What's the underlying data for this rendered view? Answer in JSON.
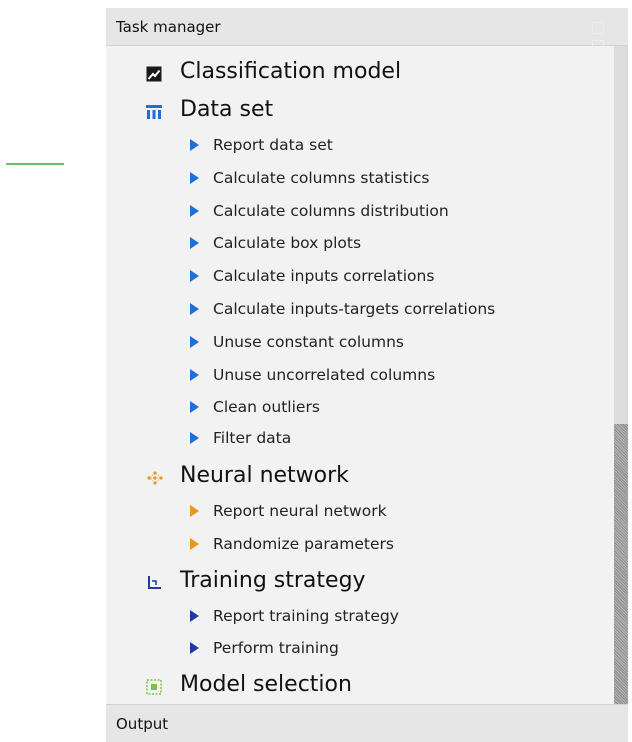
{
  "panel": {
    "title": "Task manager"
  },
  "tree": {
    "categories": [
      {
        "label": "Classification model",
        "icon": "chart-square-icon"
      },
      {
        "label": "Data set",
        "icon": "table-icon",
        "tasks": [
          "Report data set",
          "Calculate columns statistics",
          "Calculate columns distribution",
          "Calculate box plots",
          "Calculate inputs correlations",
          "Calculate inputs-targets correlations",
          "Unuse constant columns",
          "Unuse uncorrelated columns",
          "Clean outliers",
          "Filter data"
        ]
      },
      {
        "label": "Neural network",
        "icon": "network-icon",
        "tasks": [
          "Report neural network",
          "Randomize parameters"
        ]
      },
      {
        "label": "Training strategy",
        "icon": "axes-icon",
        "tasks": [
          "Report training strategy",
          "Perform training"
        ]
      },
      {
        "label": "Model selection",
        "icon": "selection-square-icon"
      }
    ]
  },
  "footer": {
    "title": "Output"
  },
  "colors": {
    "task_arrow_data_set": "#1f6fd6",
    "task_arrow_neural_network": "#e8961e",
    "task_arrow_training_strategy": "#1f3aa6",
    "green_accent": "#66c266"
  }
}
